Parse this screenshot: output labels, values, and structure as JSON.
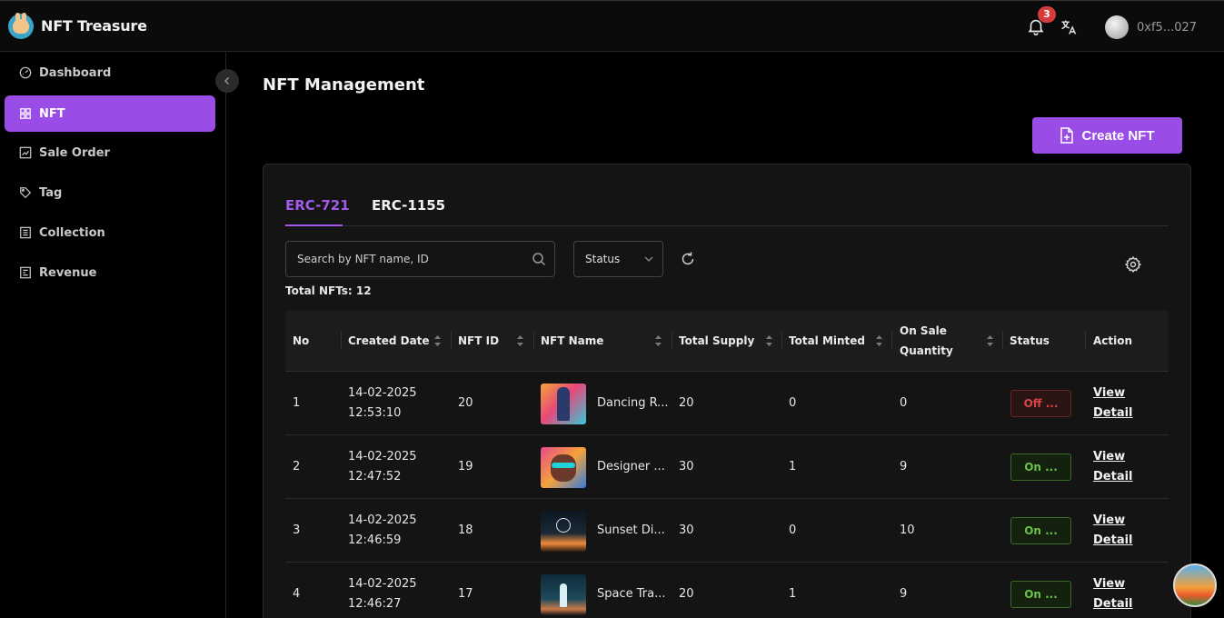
{
  "app": {
    "name": "NFT Treasure"
  },
  "header": {
    "notification_count": "3",
    "wallet": "0xf5...027"
  },
  "sidebar": {
    "items": [
      {
        "label": "Dashboard",
        "icon": "dashboard-icon",
        "active": false
      },
      {
        "label": "NFT",
        "icon": "grid-icon",
        "active": true
      },
      {
        "label": "Sale Order",
        "icon": "chart-icon",
        "active": false
      },
      {
        "label": "Tag",
        "icon": "tag-icon",
        "active": false
      },
      {
        "label": "Collection",
        "icon": "list-icon",
        "active": false
      },
      {
        "label": "Revenue",
        "icon": "revenue-icon",
        "active": false
      }
    ]
  },
  "main": {
    "title": "NFT Management",
    "create_label": "Create NFT",
    "tabs": [
      "ERC-721",
      "ERC-1155"
    ],
    "search_placeholder": "Search by NFT name, ID",
    "status_placeholder": "Status",
    "total_label": "Total NFTs:",
    "total_value": "12"
  },
  "table": {
    "columns": [
      "No",
      "Created Date",
      "NFT ID",
      "NFT Name",
      "Total Supply",
      "Total Minted",
      "On Sale Quantity",
      "Status",
      "Action"
    ],
    "rows": [
      {
        "no": "1",
        "date": "14-02-2025",
        "time": "12:53:10",
        "id": "20",
        "name": "Dancing R...",
        "supply": "20",
        "minted": "0",
        "on_sale": "0",
        "status": "Off ...",
        "status_type": "off",
        "action": "View Detail"
      },
      {
        "no": "2",
        "date": "14-02-2025",
        "time": "12:47:52",
        "id": "19",
        "name": "Designer ...",
        "supply": "30",
        "minted": "1",
        "on_sale": "9",
        "status": "On ...",
        "status_type": "on",
        "action": "View Detail"
      },
      {
        "no": "3",
        "date": "14-02-2025",
        "time": "12:46:59",
        "id": "18",
        "name": "Sunset Di...",
        "supply": "30",
        "minted": "0",
        "on_sale": "10",
        "status": "On ...",
        "status_type": "on",
        "action": "View Detail"
      },
      {
        "no": "4",
        "date": "14-02-2025",
        "time": "12:46:27",
        "id": "17",
        "name": "Space Tra...",
        "supply": "20",
        "minted": "1",
        "on_sale": "9",
        "status": "On ...",
        "status_type": "on",
        "action": "View Detail"
      }
    ]
  },
  "colors": {
    "accent": "#9a4de6",
    "off": "#d64545",
    "on": "#6cc04a"
  }
}
